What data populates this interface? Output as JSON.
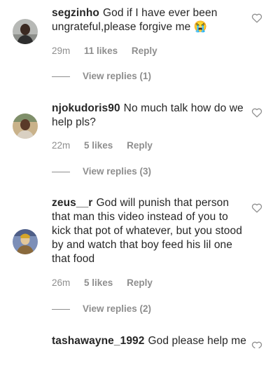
{
  "comments": [
    {
      "username": "segzinho",
      "text": "God if I have ever been ungrateful,please forgive me 😭",
      "time": "29m",
      "likes": "11 likes",
      "reply_label": "Reply",
      "view_replies": "View replies (1)"
    },
    {
      "username": "njokudoris90",
      "text": "No much talk how do we help pls?",
      "time": "22m",
      "likes": "5 likes",
      "reply_label": "Reply",
      "view_replies": "View replies (3)"
    },
    {
      "username": "zeus__r",
      "text": "God will punish that person that man this video instead of you to kick that pot of whatever, but you stood by and watch that boy feed his lil one that food",
      "time": "26m",
      "likes": "5 likes",
      "reply_label": "Reply",
      "view_replies": "View replies (2)"
    },
    {
      "username": "tashawayne_1992",
      "text": "God please help me"
    }
  ],
  "colors": {
    "text": "#262626",
    "muted": "#8e8e8e",
    "background": "#ffffff"
  },
  "icons": {
    "like": "heart-outline-icon"
  }
}
